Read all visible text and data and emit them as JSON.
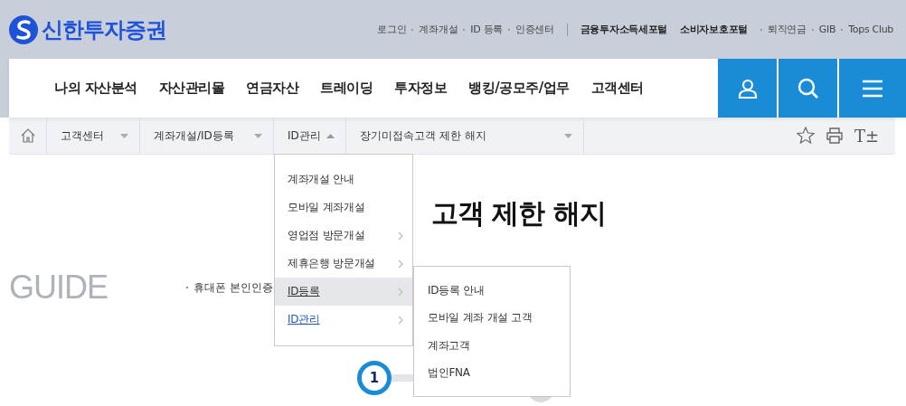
{
  "logo": {
    "text": "신한투자증권"
  },
  "top_links": [
    {
      "label": "로그인",
      "bold": false
    },
    {
      "label": "계좌개설",
      "bold": false
    },
    {
      "label": "ID 등록",
      "bold": false
    },
    {
      "label": "인증센터",
      "bold": false
    },
    {
      "label": "금융투자소득세포털",
      "bold": true
    },
    {
      "label": "소비자보호포털",
      "bold": true
    },
    {
      "label": "퇴직연금",
      "bold": false
    },
    {
      "label": "GIB",
      "bold": false
    },
    {
      "label": "Tops Club",
      "bold": false
    }
  ],
  "nav": [
    "나의 자산분석",
    "자산관리몰",
    "연금자산",
    "트레이딩",
    "투자정보",
    "뱅킹/공모주/업무",
    "고객센터"
  ],
  "nav_buttons": [
    {
      "kind": "user"
    },
    {
      "kind": "search"
    },
    {
      "kind": "menu"
    }
  ],
  "breadcrumb": [
    {
      "label": "고객센터",
      "expanded": false
    },
    {
      "label": "계좌개설/ID등록",
      "expanded": false
    },
    {
      "label": "ID관리",
      "expanded": true
    },
    {
      "label": "장기미접속고객 제한 해지",
      "expanded": false
    }
  ],
  "tools": [
    {
      "kind": "star"
    },
    {
      "kind": "print"
    },
    {
      "kind": "text",
      "label": "T±"
    }
  ],
  "title": "고객 제한 해지",
  "guide": {
    "heading": "GUIDE",
    "bullet": "휴대폰 본인인증"
  },
  "step": {
    "number": "1"
  },
  "menu": [
    {
      "label": "계좌개설 안내",
      "submenu": false,
      "selected": false,
      "current": false
    },
    {
      "label": "모바일 계좌개설",
      "submenu": false,
      "selected": false,
      "current": false
    },
    {
      "label": "영업점 방문개설",
      "submenu": true,
      "selected": false,
      "current": false
    },
    {
      "label": "제휴은행 방문개설",
      "submenu": true,
      "selected": false,
      "current": false
    },
    {
      "label": "ID등록",
      "submenu": true,
      "selected": true,
      "current": false
    },
    {
      "label": "ID관리",
      "submenu": true,
      "selected": false,
      "current": true
    }
  ],
  "submenu": [
    "ID등록 안내",
    "모바일 계좌 개설 고객",
    "계좌고객",
    "법인FNA"
  ]
}
